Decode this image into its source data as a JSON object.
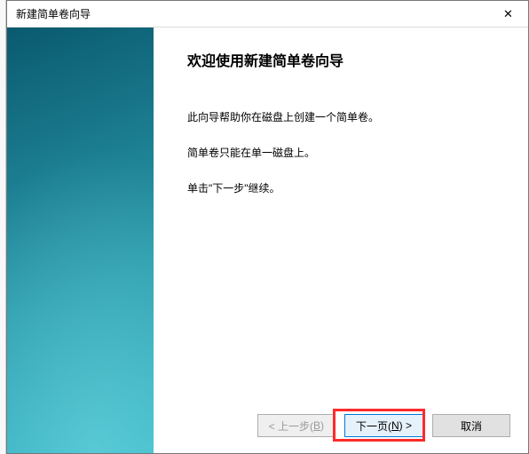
{
  "window": {
    "title": "新建简单卷向导",
    "close": "✕"
  },
  "wizard": {
    "heading": "欢迎使用新建简单卷向导",
    "para1": "此向导帮助你在磁盘上创建一个简单卷。",
    "para2": "简单卷只能在单一磁盘上。",
    "para3": "单击\"下一步\"继续。"
  },
  "buttons": {
    "back_prefix": "< 上一步(",
    "back_mnemonic": "B",
    "back_suffix": ")",
    "next_prefix": "下一页(",
    "next_mnemonic": "N",
    "next_suffix": ") >",
    "cancel": "取消"
  }
}
